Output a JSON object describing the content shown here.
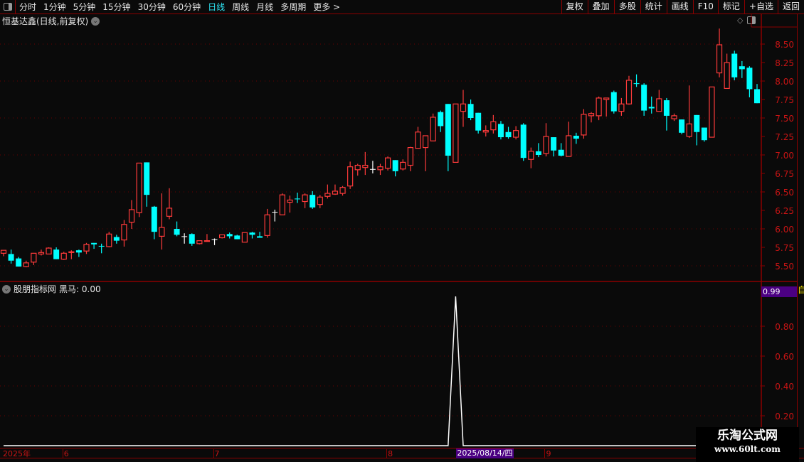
{
  "toolbar": {
    "periods": [
      "分时",
      "1分钟",
      "5分钟",
      "15分钟",
      "30分钟",
      "60分钟",
      "日线",
      "周线",
      "月线",
      "多周期",
      "更多 >"
    ],
    "active": "日线",
    "buttons": [
      "复权",
      "叠加",
      "多股",
      "统计",
      "画线",
      "F10",
      "标记",
      "+自选",
      "返回"
    ]
  },
  "chart": {
    "title": "恒基达鑫(日线,前复权)",
    "price_ticks": [
      "8.50",
      "8.25",
      "8.00",
      "7.75",
      "7.50",
      "7.25",
      "7.00",
      "6.75",
      "6.50",
      "6.25",
      "6.00",
      "5.75",
      "5.50"
    ],
    "colors": {
      "up": "#ff3b3b",
      "down": "#00ffff",
      "doji": "#ffffff",
      "axis": "#c81414"
    },
    "candles": [
      [
        5.67,
        5.71,
        5.63,
        5.71
      ],
      [
        5.66,
        5.72,
        5.53,
        5.57
      ],
      [
        5.6,
        5.62,
        5.49,
        5.49
      ],
      [
        5.49,
        5.57,
        5.48,
        5.54
      ],
      [
        5.55,
        5.67,
        5.51,
        5.67
      ],
      [
        5.66,
        5.72,
        5.64,
        5.68
      ],
      [
        5.66,
        5.75,
        5.66,
        5.74
      ],
      [
        5.72,
        5.75,
        5.59,
        5.59
      ],
      [
        5.59,
        5.69,
        5.58,
        5.67
      ],
      [
        5.68,
        5.71,
        5.59,
        5.69
      ],
      [
        5.71,
        5.72,
        5.62,
        5.68
      ],
      [
        5.7,
        5.81,
        5.66,
        5.79
      ],
      [
        5.81,
        5.81,
        5.73,
        5.79
      ],
      [
        5.77,
        5.8,
        5.67,
        5.76
      ],
      [
        5.76,
        5.96,
        5.75,
        5.93
      ],
      [
        5.89,
        5.92,
        5.8,
        5.84
      ],
      [
        5.85,
        6.12,
        5.76,
        6.06
      ],
      [
        6.09,
        6.39,
        6.0,
        6.26
      ],
      [
        6.22,
        6.89,
        6.16,
        6.89
      ],
      [
        6.9,
        6.9,
        6.3,
        6.46
      ],
      [
        6.3,
        6.31,
        5.86,
        5.96
      ],
      [
        5.9,
        6.48,
        5.72,
        6.02
      ],
      [
        6.17,
        6.55,
        6.13,
        6.28
      ],
      [
        6.0,
        6.1,
        5.9,
        5.92
      ],
      [
        5.9,
        5.94,
        5.8,
        5.9
      ],
      [
        5.93,
        5.94,
        5.77,
        5.8
      ],
      [
        5.8,
        5.84,
        5.79,
        5.84
      ],
      [
        5.83,
        5.93,
        5.83,
        5.84
      ],
      [
        5.86,
        5.87,
        5.78,
        5.86
      ],
      [
        5.88,
        5.92,
        5.87,
        5.92
      ],
      [
        5.93,
        5.95,
        5.87,
        5.9
      ],
      [
        5.91,
        5.92,
        5.86,
        5.86
      ],
      [
        5.82,
        5.95,
        5.82,
        5.95
      ],
      [
        5.95,
        5.96,
        5.87,
        5.92
      ],
      [
        5.9,
        5.96,
        5.88,
        5.88
      ],
      [
        5.91,
        6.27,
        5.88,
        6.19
      ],
      [
        6.23,
        6.26,
        6.1,
        6.23
      ],
      [
        6.19,
        6.48,
        6.19,
        6.46
      ],
      [
        6.36,
        6.45,
        6.22,
        6.39
      ],
      [
        6.41,
        6.49,
        6.35,
        6.4
      ],
      [
        6.37,
        6.48,
        6.28,
        6.46
      ],
      [
        6.46,
        6.51,
        6.27,
        6.29
      ],
      [
        6.33,
        6.46,
        6.28,
        6.43
      ],
      [
        6.44,
        6.6,
        6.41,
        6.48
      ],
      [
        6.47,
        6.6,
        6.46,
        6.51
      ],
      [
        6.48,
        6.58,
        6.45,
        6.56
      ],
      [
        6.58,
        6.91,
        6.54,
        6.84
      ],
      [
        6.8,
        6.88,
        6.72,
        6.86
      ],
      [
        6.83,
        7.04,
        6.73,
        6.86
      ],
      [
        6.81,
        6.92,
        6.75,
        6.81
      ],
      [
        6.8,
        6.88,
        6.73,
        6.84
      ],
      [
        6.82,
        6.98,
        6.79,
        6.96
      ],
      [
        6.93,
        6.93,
        6.71,
        6.78
      ],
      [
        6.81,
        6.94,
        6.79,
        6.9
      ],
      [
        6.86,
        7.11,
        6.78,
        7.1
      ],
      [
        7.09,
        7.38,
        7.09,
        7.31
      ],
      [
        7.1,
        7.26,
        6.78,
        7.26
      ],
      [
        7.19,
        7.56,
        7.19,
        7.51
      ],
      [
        7.58,
        7.6,
        7.31,
        7.39
      ],
      [
        7.69,
        7.69,
        6.78,
        6.99
      ],
      [
        6.9,
        7.69,
        6.9,
        7.69
      ],
      [
        7.59,
        7.88,
        7.38,
        7.69
      ],
      [
        7.69,
        7.75,
        7.47,
        7.5
      ],
      [
        7.57,
        7.57,
        7.29,
        7.33
      ],
      [
        7.31,
        7.4,
        7.25,
        7.33
      ],
      [
        7.34,
        7.54,
        7.29,
        7.45
      ],
      [
        7.42,
        7.46,
        7.21,
        7.24
      ],
      [
        7.31,
        7.38,
        7.22,
        7.24
      ],
      [
        7.24,
        7.39,
        7.21,
        7.33
      ],
      [
        7.41,
        7.43,
        6.92,
        6.96
      ],
      [
        6.94,
        7.1,
        6.82,
        7.05
      ],
      [
        7.05,
        7.16,
        6.97,
        7.0
      ],
      [
        7.02,
        7.43,
        6.98,
        7.25
      ],
      [
        7.24,
        7.24,
        6.98,
        7.06
      ],
      [
        7.07,
        7.16,
        6.98,
        6.99
      ],
      [
        6.98,
        7.45,
        6.98,
        7.26
      ],
      [
        7.26,
        7.3,
        7.15,
        7.22
      ],
      [
        7.27,
        7.62,
        7.22,
        7.55
      ],
      [
        7.53,
        7.58,
        7.44,
        7.56
      ],
      [
        7.53,
        7.79,
        7.47,
        7.77
      ],
      [
        7.75,
        7.77,
        7.52,
        7.77
      ],
      [
        7.85,
        7.87,
        7.56,
        7.59
      ],
      [
        7.59,
        7.77,
        7.53,
        7.69
      ],
      [
        7.69,
        8.07,
        7.68,
        8.01
      ],
      [
        7.97,
        8.09,
        7.92,
        7.96
      ],
      [
        7.95,
        7.97,
        7.53,
        7.6
      ],
      [
        7.65,
        7.79,
        7.56,
        7.63
      ],
      [
        7.59,
        7.88,
        7.59,
        7.76
      ],
      [
        7.74,
        7.77,
        7.33,
        7.53
      ],
      [
        7.49,
        7.56,
        7.46,
        7.53
      ],
      [
        7.48,
        7.48,
        7.28,
        7.3
      ],
      [
        7.25,
        7.94,
        7.23,
        7.42
      ],
      [
        7.54,
        7.54,
        7.13,
        7.31
      ],
      [
        7.37,
        7.37,
        7.18,
        7.2
      ],
      [
        7.24,
        7.92,
        7.24,
        7.92
      ],
      [
        8.11,
        8.71,
        8.05,
        8.49
      ],
      [
        7.9,
        8.37,
        7.9,
        8.25
      ],
      [
        8.37,
        8.41,
        8.01,
        8.05
      ],
      [
        8.2,
        8.27,
        8.04,
        8.16
      ],
      [
        8.18,
        8.2,
        7.78,
        7.89
      ],
      [
        7.89,
        7.96,
        7.7,
        7.7
      ]
    ]
  },
  "indicator": {
    "title": "股朋指标网",
    "series_label": "黑马: 0.00",
    "current_value": "0.99",
    "ticks": [
      "0.80",
      "0.60",
      "0.40",
      "0.20"
    ],
    "signal_index": 60,
    "signal_value": 1.0,
    "line_color": "#ffffff"
  },
  "date_axis": {
    "year_label": "2025年",
    "months": [
      {
        "label": "6",
        "index": 8
      },
      {
        "label": "7",
        "index": 28
      },
      {
        "label": "8",
        "index": 51
      },
      {
        "label": "9",
        "index": 72
      }
    ],
    "cursor_date": "2025/08/14/四"
  },
  "side_label": "自",
  "watermark": {
    "name": "乐淘公式网",
    "url": "www.60lt.com"
  }
}
